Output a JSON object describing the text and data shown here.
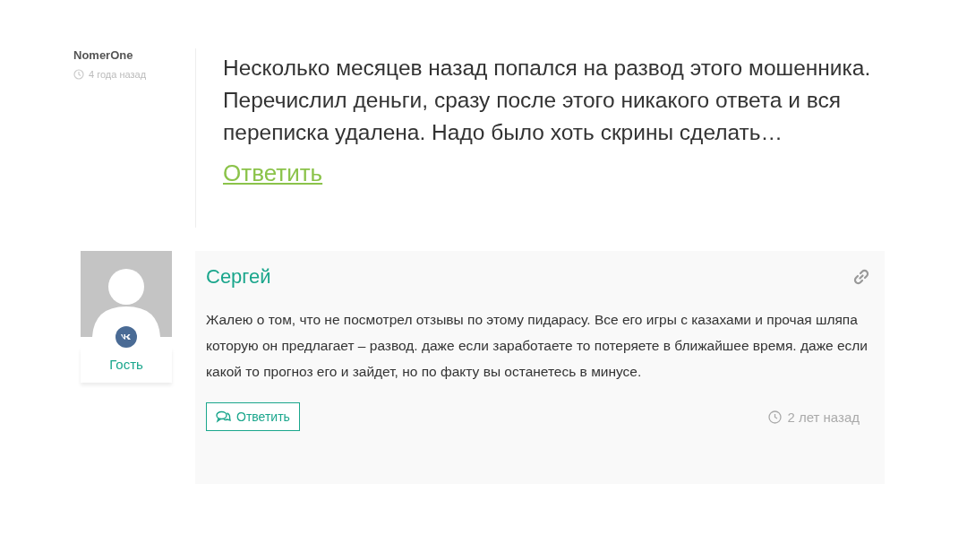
{
  "comments": [
    {
      "kind": "plain",
      "author": "NomerOne",
      "time": "4 года назад",
      "text": "Несколько месяцев назад попался на развод этого мошенника. Перечислил деньги, сразу после этого никакого ответа и вся переписка удалена. Надо было хоть скрины сделать…",
      "reply": "Ответить"
    },
    {
      "kind": "card",
      "author": "Сергей",
      "badge": "Гость",
      "time": "2 лет назад",
      "text": "Жалею о том, что не посмотрел отзывы по этому пидарасу. Все его игры с казахами и прочая шляпа которую он предлагает – развод. даже если заработаете то потеряете в ближайшее время. даже если какой то прогноз его и зайдет, но по факту вы останетесь в минусе.",
      "reply": "Ответить"
    }
  ]
}
